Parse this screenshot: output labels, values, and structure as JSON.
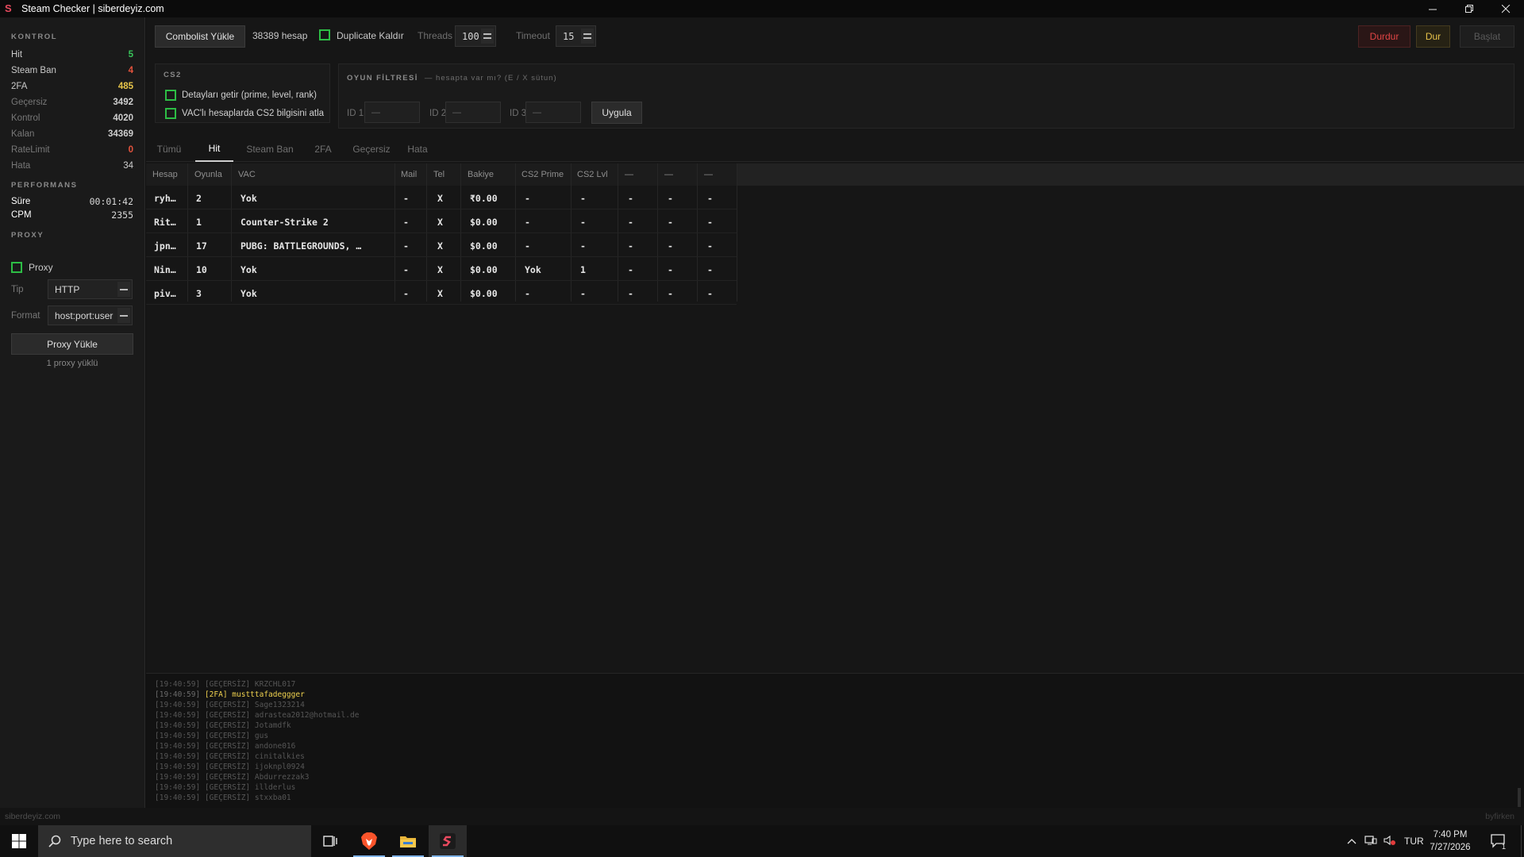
{
  "window": {
    "title": "Steam Checker | siberdeyiz.com",
    "icon": "app-s-icon"
  },
  "sidebar": {
    "kontrol_title": "KONTROL",
    "stats": [
      {
        "label": "Hit",
        "value": "5",
        "color": "#38c45a"
      },
      {
        "label": "Steam Ban",
        "value": "4",
        "color": "#e5533d"
      },
      {
        "label": "2FA",
        "value": "485",
        "color": "#e8c64a"
      },
      {
        "label": "Geçersiz",
        "value": "3492",
        "color": "#cfcfcf"
      },
      {
        "label": "Kontrol",
        "value": "4020",
        "color": "#cfcfcf"
      },
      {
        "label": "Kalan",
        "value": "34369",
        "color": "#cfcfcf"
      },
      {
        "label": "RateLimit",
        "value": "0",
        "color": "#e5533d"
      },
      {
        "label": "Hata",
        "value": "34",
        "color": "#cfcfcf"
      }
    ],
    "performans_title": "PERFORMANS",
    "performans": [
      {
        "label": "Süre",
        "value": "00:01:42"
      },
      {
        "label": "CPM",
        "value": "2355"
      }
    ],
    "proxy_title": "PROXY",
    "proxy_checkbox_label": "Proxy",
    "tip_label": "Tip",
    "tip_value": "HTTP",
    "format_label": "Format",
    "format_value": "host:port:user",
    "proxy_button": "Proxy Yükle",
    "proxy_count": "1 proxy yüklü"
  },
  "toolbar": {
    "combolist_button": "Combolist Yükle",
    "account_count": "38389 hesap",
    "duplicate_label": "Duplicate Kaldır",
    "threads_label": "Threads",
    "threads_value": "100",
    "timeout_label": "Timeout",
    "timeout_value": "15",
    "stop_button": "Durdur",
    "pause_button": "Dur",
    "start_button": "Başlat"
  },
  "cs2_panel": {
    "title": "CS2",
    "opt1": "Detayları getir  (prime, level, rank)",
    "opt2": "VAC'lı hesaplarda CS2 bilgisini atla"
  },
  "game_filter": {
    "title": "OYUN FİLTRESİ",
    "subtitle": "—  hesapta var mı? (E / X sütun)",
    "id1_label": "ID 1",
    "id2_label": "ID 2",
    "id3_label": "ID 3",
    "id_placeholder": "—",
    "apply_button": "Uygula"
  },
  "tabs": [
    "Tümü",
    "Hit",
    "Steam Ban",
    "2FA",
    "Geçersiz",
    "Hata"
  ],
  "active_tab": "Hit",
  "table": {
    "headers": [
      "Hesap",
      "Oyunla",
      "VAC",
      "Mail",
      "Tel",
      "Bakiye",
      "CS2 Prime",
      "CS2 Lvl",
      "—",
      "—",
      "—"
    ],
    "rows": [
      [
        "ryh…",
        "2",
        "Yok",
        "-",
        "X",
        "₹0.00",
        "-",
        "-",
        "-",
        "-",
        "-"
      ],
      [
        "Rit…",
        "1",
        "Counter-Strike 2",
        "-",
        "X",
        "$0.00",
        "-",
        "-",
        "-",
        "-",
        "-"
      ],
      [
        "jpn…",
        "17",
        "PUBG: BATTLEGROUNDS, …",
        "-",
        "X",
        "$0.00",
        "-",
        "-",
        "-",
        "-",
        "-"
      ],
      [
        "Nin…",
        "10",
        "Yok",
        "-",
        "X",
        "$0.00",
        "Yok",
        "1",
        "-",
        "-",
        "-"
      ],
      [
        "piv…",
        "3",
        "Yok",
        "-",
        "X",
        "$0.00",
        "-",
        "-",
        "-",
        "-",
        "-"
      ]
    ]
  },
  "log": [
    {
      "ts": "[19:40:59]",
      "tag": "[GEÇERSİZ]",
      "text": "KRZCHL017",
      "highlight": false
    },
    {
      "ts": "[19:40:59]",
      "tag": "[2FA]",
      "text": "mustttafadeggger",
      "highlight": true
    },
    {
      "ts": "[19:40:59]",
      "tag": "[GEÇERSİZ]",
      "text": "Sage1323214",
      "highlight": false
    },
    {
      "ts": "[19:40:59]",
      "tag": "[GEÇERSİZ]",
      "text": "adrastea2012@hotmail.de",
      "highlight": false
    },
    {
      "ts": "[19:40:59]",
      "tag": "[GEÇERSİZ]",
      "text": "Jotamdfk",
      "highlight": false
    },
    {
      "ts": "[19:40:59]",
      "tag": "[GEÇERSİZ]",
      "text": "gus",
      "highlight": false
    },
    {
      "ts": "[19:40:59]",
      "tag": "[GEÇERSİZ]",
      "text": "andone016",
      "highlight": false
    },
    {
      "ts": "[19:40:59]",
      "tag": "[GEÇERSİZ]",
      "text": "cinitalkies",
      "highlight": false
    },
    {
      "ts": "[19:40:59]",
      "tag": "[GEÇERSİZ]",
      "text": "ijoknpl0924",
      "highlight": false
    },
    {
      "ts": "[19:40:59]",
      "tag": "[GEÇERSİZ]",
      "text": "Abdurrezzak3",
      "highlight": false
    },
    {
      "ts": "[19:40:59]",
      "tag": "[GEÇERSİZ]",
      "text": "illderlus",
      "highlight": false
    },
    {
      "ts": "[19:40:59]",
      "tag": "[GEÇERSİZ]",
      "text": "stxxba01",
      "highlight": false
    }
  ],
  "statusbar": {
    "left": "siberdeyiz.com",
    "right": "byfirken"
  },
  "taskbar": {
    "search_placeholder": "Type here to search",
    "language": "TUR",
    "time": "7:40 PM",
    "date": "7/27/2026",
    "notification_count": "1"
  }
}
